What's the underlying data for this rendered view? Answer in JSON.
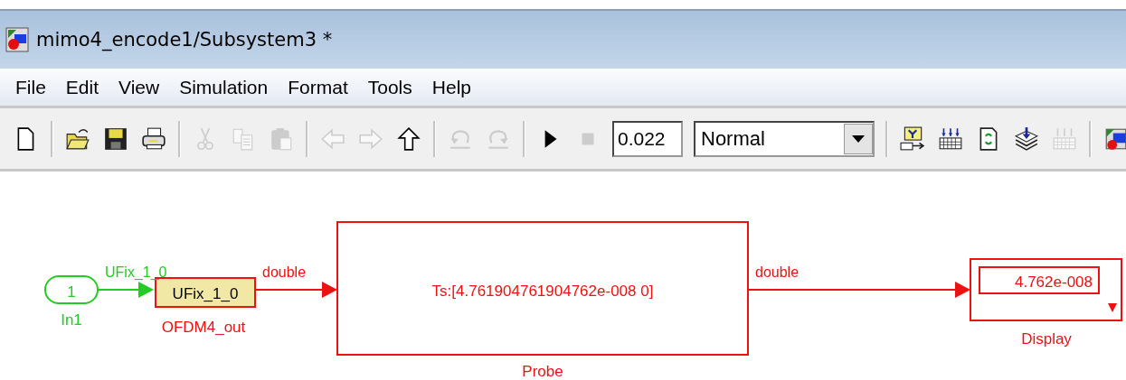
{
  "window": {
    "title": "mimo4_encode1/Subsystem3 *"
  },
  "menu": [
    "File",
    "Edit",
    "View",
    "Simulation",
    "Format",
    "Tools",
    "Help"
  ],
  "toolbar": [
    {
      "kind": "button",
      "disabled": false
    },
    {
      "kind": "separator"
    },
    {
      "kind": "button",
      "disabled": false
    },
    {
      "kind": "button",
      "disabled": false
    },
    {
      "kind": "button",
      "disabled": false
    },
    {
      "kind": "separator"
    },
    {
      "kind": "button",
      "disabled": true
    },
    {
      "kind": "button",
      "disabled": true
    },
    {
      "kind": "button",
      "disabled": true
    },
    {
      "kind": "separator"
    },
    {
      "kind": "button",
      "disabled": true
    },
    {
      "kind": "button",
      "disabled": true
    },
    {
      "kind": "button",
      "disabled": false
    },
    {
      "kind": "separator"
    },
    {
      "kind": "button",
      "disabled": true
    },
    {
      "kind": "button",
      "disabled": true
    },
    {
      "kind": "separator"
    },
    {
      "kind": "button",
      "disabled": false
    },
    {
      "kind": "button",
      "disabled": true
    },
    {
      "kind": "field",
      "value": "0.022"
    },
    {
      "kind": "dropdown",
      "value": "Normal"
    },
    {
      "kind": "separator"
    },
    {
      "kind": "button",
      "disabled": false
    },
    {
      "kind": "button",
      "disabled": false
    },
    {
      "kind": "button",
      "disabled": false
    },
    {
      "kind": "button",
      "disabled": false
    },
    {
      "kind": "button",
      "disabled": true
    },
    {
      "kind": "separator"
    },
    {
      "kind": "button",
      "disabled": false
    }
  ],
  "diagram": {
    "blocks": [
      {
        "kind": "inport",
        "text": "1",
        "label": "In1",
        "color": "#22cc22"
      },
      {
        "kind": "conversion",
        "text": "UFix_1_0",
        "label": "OFDM4_out",
        "color": "#ee1111"
      },
      {
        "kind": "probe",
        "text": "Ts:[4.761904761904762e-008 0]",
        "label": "Probe",
        "color": "#ee1111"
      },
      {
        "kind": "display",
        "text": "4.762e-008",
        "label": "Display",
        "color": "#ee1111"
      }
    ],
    "signals": [
      {
        "label": "UFix_1_0",
        "color": "#22cc22"
      },
      {
        "label": "double",
        "color": "#ee1111"
      },
      {
        "label": "double",
        "color": "#ee1111"
      }
    ]
  }
}
